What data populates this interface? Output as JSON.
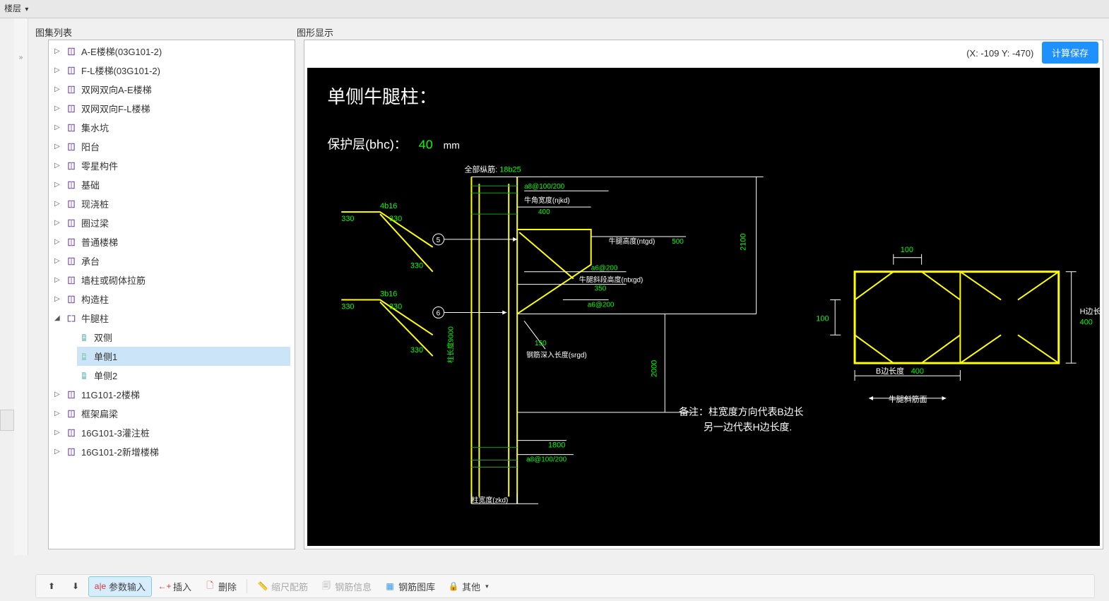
{
  "topbar": {
    "label": "楼层"
  },
  "sidebar": {
    "title": "图集列表",
    "items": [
      {
        "label": "A-E楼梯(03G101-2)",
        "kind": "book"
      },
      {
        "label": "F-L楼梯(03G101-2)",
        "kind": "book"
      },
      {
        "label": "双网双向A-E楼梯",
        "kind": "book"
      },
      {
        "label": "双网双向F-L楼梯",
        "kind": "book"
      },
      {
        "label": "集水坑",
        "kind": "book"
      },
      {
        "label": "阳台",
        "kind": "book"
      },
      {
        "label": "零星构件",
        "kind": "book"
      },
      {
        "label": "基础",
        "kind": "book"
      },
      {
        "label": "现浇桩",
        "kind": "book"
      },
      {
        "label": "圈过梁",
        "kind": "book"
      },
      {
        "label": "普通楼梯",
        "kind": "book"
      },
      {
        "label": "承台",
        "kind": "book"
      },
      {
        "label": "墙柱或砌体拉筋",
        "kind": "book"
      },
      {
        "label": "构造柱",
        "kind": "book"
      },
      {
        "label": "牛腿柱",
        "kind": "book-open",
        "expanded": true,
        "children": [
          {
            "label": "双侧"
          },
          {
            "label": "单侧1",
            "selected": true
          },
          {
            "label": "单侧2"
          }
        ]
      },
      {
        "label": "11G101-2楼梯",
        "kind": "book"
      },
      {
        "label": "框架扁梁",
        "kind": "book"
      },
      {
        "label": "16G101-3灌注桩",
        "kind": "book"
      },
      {
        "label": "16G101-2新增楼梯",
        "kind": "book"
      }
    ]
  },
  "right": {
    "title": "图形显示",
    "coords": "(X: -109 Y: -470)",
    "calc_button": "计算保存"
  },
  "drawing": {
    "title": "单侧牛腿柱：",
    "cover_label": "保护层(bhc)：",
    "cover_value": "40",
    "cover_unit": "mm",
    "column_label": "全部纵筋:",
    "column_value": "18b25",
    "a8_100_200": "a8@100/200",
    "njkd_label": "牛角宽度(njkd)",
    "njkd_value": "400",
    "ntgd_label": "牛腿高度(ntgd)",
    "ntgd_value": "500",
    "a6_200": "a6@200",
    "ntxgd_label": "牛腿斜段高度(ntxgd)",
    "ntxgd_value": "350",
    "a6_200_2": "a6@200",
    "r150": "150",
    "srgd_label": "钢筋深入长度(srgd)",
    "height_2100": "2100",
    "height_2000": "2000",
    "height_1800": "1800",
    "height_9000": "柱长度9000",
    "width_label": "柱宽度(zkd)",
    "upper_rebar": "4b16",
    "upper_330_1": "330",
    "upper_330_2": "330",
    "upper_330_3": "330",
    "lower_rebar": "3b16",
    "lower_330_1": "330",
    "lower_330_2": "330",
    "lower_330_3": "330",
    "node5": "5",
    "node6": "6",
    "note": "备注：柱宽度方向代表B边长\n           另一边代表H边长度.",
    "section_b_label": "B边长度",
    "section_b_value": "400",
    "section_h_label": "H边长度",
    "section_h_value": "400",
    "section_100_1": "100",
    "section_100_2": "100",
    "section_bottom": "牛腿斜筋面"
  },
  "toolbar": {
    "param_input": "参数输入",
    "insert": "插入",
    "delete": "删除",
    "scale": "缩尺配筋",
    "rebar_info": "钢筋信息",
    "rebar_lib": "钢筋图库",
    "other": "其他"
  }
}
